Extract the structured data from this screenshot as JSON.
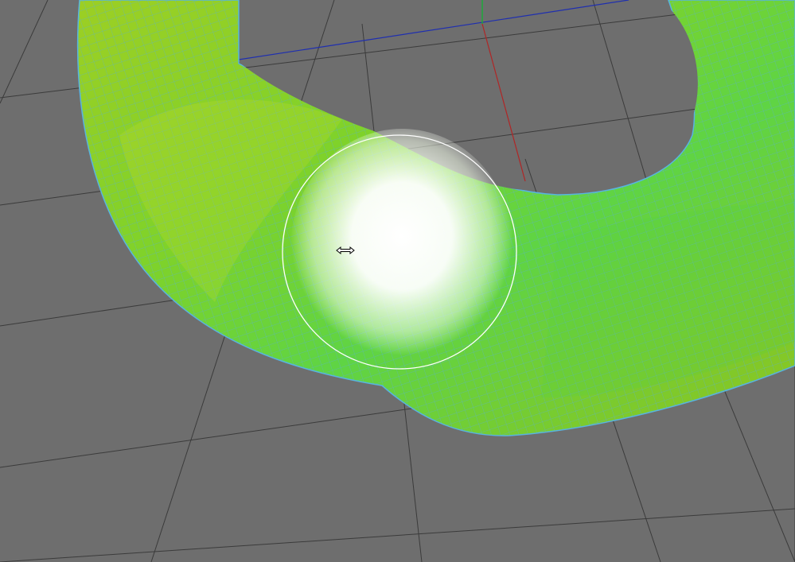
{
  "viewport": {
    "background_color": "#6e6e6e",
    "grid_color": "#3a3a3a",
    "axes": {
      "x_axis_color": "#1f2fb0",
      "y_axis_color": "#1fa83a",
      "z_axis_color": "#b02626"
    }
  },
  "mesh": {
    "shape": "torus",
    "display_mode": "wireframe-on-shaded",
    "surface_colors": [
      "#7fcf1e",
      "#a8d428",
      "#5fd33a",
      "#9cc41c"
    ],
    "wire_color": "#58b4e0"
  },
  "brush": {
    "tool": "sculpt-brush",
    "ring_color": "#ffffff",
    "highlight_color": "#ffffff"
  },
  "cursor": {
    "icon": "horizontal-resize-icon"
  }
}
